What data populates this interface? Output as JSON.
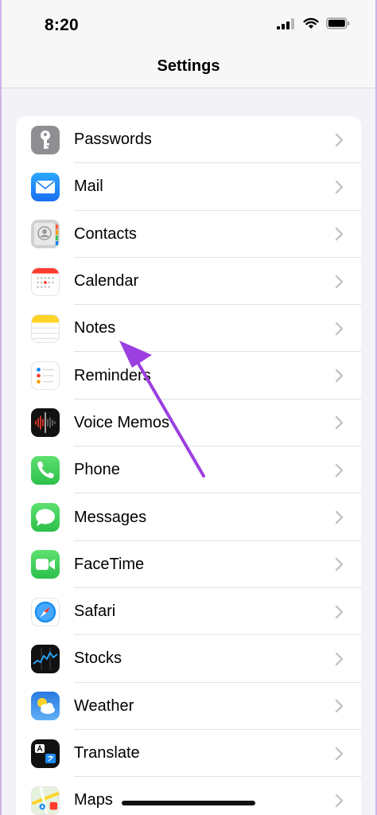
{
  "status_bar": {
    "time": "8:20"
  },
  "nav": {
    "title": "Settings"
  },
  "settings": {
    "items": [
      {
        "label": "Passwords",
        "icon": "key-icon",
        "color": "#8e8e93"
      },
      {
        "label": "Mail",
        "icon": "mail-icon",
        "color": "#1e8cf5"
      },
      {
        "label": "Contacts",
        "icon": "contacts-icon",
        "color": "#c9c9c9"
      },
      {
        "label": "Calendar",
        "icon": "calendar-icon",
        "color": "#ffffff"
      },
      {
        "label": "Notes",
        "icon": "notes-icon",
        "color": "#ffffff"
      },
      {
        "label": "Reminders",
        "icon": "reminders-icon",
        "color": "#ffffff"
      },
      {
        "label": "Voice Memos",
        "icon": "voice-memos-icon",
        "color": "#111111"
      },
      {
        "label": "Phone",
        "icon": "phone-icon",
        "color": "#34c759"
      },
      {
        "label": "Messages",
        "icon": "messages-icon",
        "color": "#34c759"
      },
      {
        "label": "FaceTime",
        "icon": "facetime-icon",
        "color": "#34c759"
      },
      {
        "label": "Safari",
        "icon": "safari-icon",
        "color": "#ffffff"
      },
      {
        "label": "Stocks",
        "icon": "stocks-icon",
        "color": "#111111"
      },
      {
        "label": "Weather",
        "icon": "weather-icon",
        "color": "#2f7ee6"
      },
      {
        "label": "Translate",
        "icon": "translate-icon",
        "color": "#111111"
      },
      {
        "label": "Maps",
        "icon": "maps-icon",
        "color": "#e8f3e3"
      }
    ]
  },
  "annotation": {
    "color": "#9b3fe0",
    "target": "Notes"
  }
}
